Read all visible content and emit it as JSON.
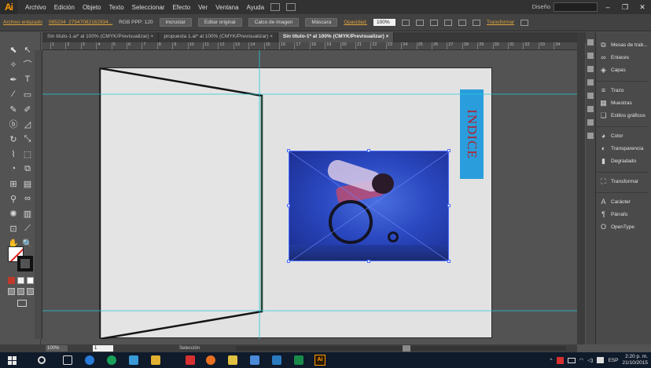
{
  "app": {
    "logo": "Ai"
  },
  "menu": [
    "Archivo",
    "Edición",
    "Objeto",
    "Texto",
    "Seleccionar",
    "Efecto",
    "Ver",
    "Ventana",
    "Ayuda"
  ],
  "workspace": "Diseño",
  "window_controls": [
    "–",
    "❐",
    "✕"
  ],
  "control_bar": {
    "linked_file": "Archivo enlazado",
    "file_name": "085234_27947082162934...",
    "color_info": "RGB PPP: 120",
    "embed": "Incrustar",
    "edit_original": "Editar original",
    "image_trace": "Calco de imagen",
    "mask": "Máscara",
    "opacity_label": "Opacidad:",
    "opacity_value": "100%",
    "transform": "Transformar"
  },
  "tabs": [
    {
      "label": "Sin título-1.ai* al 100% (CMYK/Previsualizar)",
      "close": "×"
    },
    {
      "label": "propuesta 1.ai* al 100% (CMYK/Previsualizar)",
      "close": "×"
    },
    {
      "label": "Sin título-1* al 100% (CMYK/Previsualizar)",
      "close": "×"
    }
  ],
  "ruler_ticks": [
    "1",
    "2",
    "3",
    "4",
    "5",
    "6",
    "7",
    "8",
    "9",
    "10",
    "11",
    "12",
    "13",
    "14",
    "15",
    "16",
    "17",
    "18",
    "19",
    "20",
    "21",
    "22",
    "23",
    "24",
    "25",
    "26",
    "27",
    "28",
    "29",
    "30",
    "31",
    "32",
    "33",
    "34"
  ],
  "tools": [
    "selection-icon",
    "direct-selection-icon",
    "magic-wand-icon",
    "lasso-icon",
    "pen-icon",
    "type-icon",
    "line-icon",
    "rectangle-icon",
    "paintbrush-icon",
    "pencil-icon",
    "blob-brush-icon",
    "eraser-icon",
    "rotate-icon",
    "scale-icon",
    "width-icon",
    "free-transform-icon",
    "shape-builder-icon",
    "perspective-icon",
    "mesh-icon",
    "gradient-icon",
    "eyedropper-icon",
    "blend-icon",
    "symbol-sprayer-icon",
    "column-graph-icon",
    "artboard-icon",
    "slice-icon",
    "hand-icon",
    "zoom-icon"
  ],
  "tool_glyphs": [
    "⬉",
    "↖",
    "✧",
    "⌒",
    "✒",
    "T",
    "⁄",
    "▭",
    "✎",
    "✐",
    "ⓑ",
    "◿",
    "↻",
    "⤡",
    "⌇",
    "⬚",
    "◔",
    "⧉",
    "⊞",
    "▤",
    "⚲",
    "∞",
    "✺",
    "▥",
    "⊡",
    "⟋",
    "✋",
    "🔍"
  ],
  "artboard": {
    "index_text": "INDICE"
  },
  "panels": [
    {
      "icon": "⧉",
      "label": "Mesas de trab...",
      "name": "panel-artboards"
    },
    {
      "icon": "∞",
      "label": "Enlaces",
      "name": "panel-links"
    },
    {
      "icon": "◈",
      "label": "Capas",
      "name": "panel-layers",
      "gap_after": true
    },
    {
      "icon": "≡",
      "label": "Trazo",
      "name": "panel-stroke"
    },
    {
      "icon": "▦",
      "label": "Muestras",
      "name": "panel-swatches"
    },
    {
      "icon": "❏",
      "label": "Estilos gráficos",
      "name": "panel-graphic-styles",
      "gap_after": true
    },
    {
      "icon": "◕",
      "label": "Color",
      "name": "panel-color"
    },
    {
      "icon": "◐",
      "label": "Transparencia",
      "name": "panel-transparency"
    },
    {
      "icon": "▮",
      "label": "Degradado",
      "name": "panel-gradient",
      "gap_after": true
    },
    {
      "icon": "⛶",
      "label": "Transformar",
      "name": "panel-transform",
      "gap_after": true
    },
    {
      "icon": "A",
      "label": "Carácter",
      "name": "panel-character"
    },
    {
      "icon": "¶",
      "label": "Párrafo",
      "name": "panel-paragraph"
    },
    {
      "icon": "O",
      "label": "OpenType",
      "name": "panel-opentype"
    }
  ],
  "status": {
    "zoom": "100%",
    "artboard_number": "1",
    "current_tool": "Selección"
  },
  "taskbar": {
    "ai_label": "Ai",
    "language": "ESP",
    "time": "2:20 p. m.",
    "date": "21/10/2015"
  },
  "colors": {
    "accent_orange": "#ff9a00",
    "index_box": "#2a9edc",
    "index_text": "#b02030",
    "guide": "#27c7d6",
    "selection": "#4a6cff"
  }
}
